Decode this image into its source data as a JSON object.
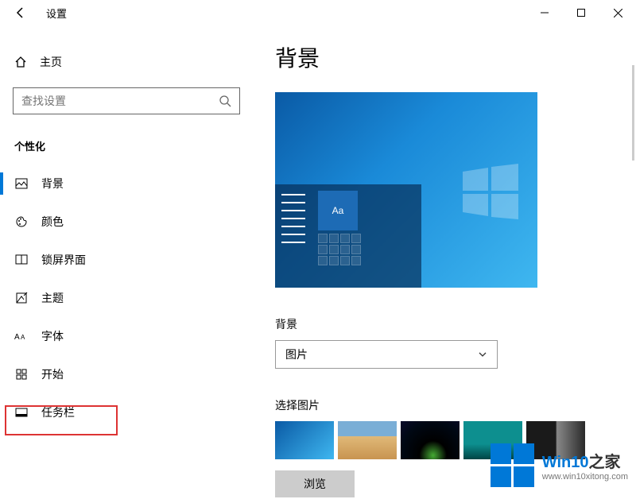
{
  "titlebar": {
    "title": "设置"
  },
  "sidebar": {
    "home_label": "主页",
    "search_placeholder": "查找设置",
    "section_label": "个性化",
    "items": [
      {
        "label": "背景",
        "icon": "image-icon"
      },
      {
        "label": "颜色",
        "icon": "palette-icon"
      },
      {
        "label": "锁屏界面",
        "icon": "lockscreen-icon"
      },
      {
        "label": "主题",
        "icon": "theme-icon"
      },
      {
        "label": "字体",
        "icon": "font-icon"
      },
      {
        "label": "开始",
        "icon": "start-icon"
      },
      {
        "label": "任务栏",
        "icon": "taskbar-icon"
      }
    ]
  },
  "main": {
    "page_title": "背景",
    "preview_sample": "Aa",
    "bg_label": "背景",
    "bg_dropdown_value": "图片",
    "choose_label": "选择图片",
    "browse_label": "浏览"
  },
  "watermark": {
    "brand_prefix": "Win10",
    "brand_suffix": "之家",
    "url": "www.win10xitong.com"
  }
}
